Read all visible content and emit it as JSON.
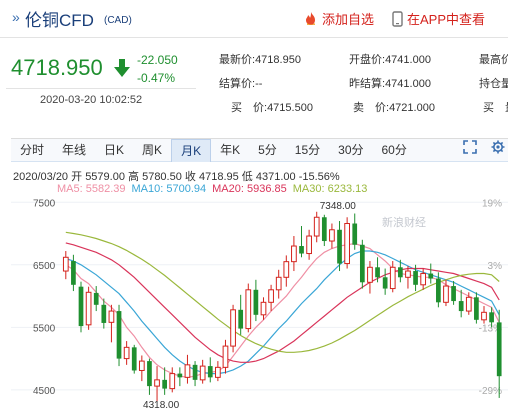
{
  "header": {
    "title_arrow": "»",
    "title": "伦铜CFD",
    "title_sub": "(CAD)",
    "add_watch_label": "添加自选",
    "app_view_label": "在APP中查看",
    "accent_color": "#d4221c"
  },
  "quote": {
    "price": "4718.950",
    "direction": "down",
    "change": "-22.050",
    "change_pct": "-0.47%",
    "timestamp": "2020-03-20 10:02:52",
    "down_color": "#1f8f2f"
  },
  "fields": {
    "col1": [
      {
        "label": "最新价:",
        "value": "4718.950"
      },
      {
        "label": "结算价:",
        "value": "--"
      },
      {
        "label": "买　价:",
        "value": "4715.500"
      }
    ],
    "col2": [
      {
        "label": "开盘价:",
        "value": "4741.000"
      },
      {
        "label": "昨结算:",
        "value": "4741.000"
      },
      {
        "label": "卖　价:",
        "value": "4721.000"
      }
    ],
    "col3": [
      {
        "label": "最高价:",
        "value": ""
      },
      {
        "label": "持仓量:",
        "value": ""
      },
      {
        "label": "买　量:",
        "value": ""
      }
    ]
  },
  "tabs": [
    "分时",
    "年线",
    "日K",
    "周K",
    "月K",
    "年K",
    "5分",
    "15分",
    "30分",
    "60分"
  ],
  "active_tab": 4,
  "tools": [
    "expand-icon",
    "settings-icon"
  ],
  "info": {
    "date": "2020/03/20",
    "open_label": "开",
    "open": "5579.00",
    "high_label": "高",
    "high": "5780.50",
    "close_label": "收",
    "close": "4718.95",
    "low_label": "低",
    "low": "4371.00",
    "change_pct": "-15.56%",
    "ma": [
      {
        "label": "MA5:",
        "value": "5582.39",
        "color": "#ef8fa4"
      },
      {
        "label": "MA10:",
        "value": "5700.94",
        "color": "#3aa6d6"
      },
      {
        "label": "MA20:",
        "value": "5936.85",
        "color": "#d9345a"
      },
      {
        "label": "MA30:",
        "value": "6233.13",
        "color": "#9ab83c"
      }
    ]
  },
  "chart_data": {
    "type": "candlestick",
    "y_ticks": [
      "7500",
      "6500",
      "5500",
      "4500"
    ],
    "y_tick_values": [
      7500,
      6500,
      5500,
      4500
    ],
    "pct_ticks": [
      "19%",
      "3%",
      "-13%",
      "-29%"
    ],
    "pct_tick_values": [
      7500,
      6500,
      5500,
      4500
    ],
    "ylim": [
      4210,
      7600
    ],
    "watermark": "新浪财经",
    "high_marker": "7348.00",
    "low_marker": "4318.00",
    "up_color": "#d4221c",
    "down_color": "#1f8f2f",
    "candles": [
      {
        "o": 6400,
        "h": 6720,
        "l": 6270,
        "c": 6620
      },
      {
        "o": 6560,
        "h": 6660,
        "l": 6080,
        "c": 6180
      },
      {
        "o": 6150,
        "h": 6230,
        "l": 5420,
        "c": 5520
      },
      {
        "o": 5540,
        "h": 6150,
        "l": 5460,
        "c": 6060
      },
      {
        "o": 6050,
        "h": 6160,
        "l": 5760,
        "c": 5860
      },
      {
        "o": 5860,
        "h": 5960,
        "l": 5480,
        "c": 5570
      },
      {
        "o": 5580,
        "h": 5860,
        "l": 5260,
        "c": 5760
      },
      {
        "o": 5760,
        "h": 5860,
        "l": 4880,
        "c": 5000
      },
      {
        "o": 5000,
        "h": 5280,
        "l": 4900,
        "c": 5180
      },
      {
        "o": 5180,
        "h": 5220,
        "l": 4760,
        "c": 4810
      },
      {
        "o": 4810,
        "h": 5050,
        "l": 4640,
        "c": 4960
      },
      {
        "o": 4960,
        "h": 5000,
        "l": 4420,
        "c": 4560
      },
      {
        "o": 4560,
        "h": 4880,
        "l": 4318,
        "c": 4660
      },
      {
        "o": 4660,
        "h": 4860,
        "l": 4420,
        "c": 4520
      },
      {
        "o": 4520,
        "h": 4860,
        "l": 4460,
        "c": 4760
      },
      {
        "o": 4760,
        "h": 4860,
        "l": 4560,
        "c": 4700
      },
      {
        "o": 4700,
        "h": 5060,
        "l": 4600,
        "c": 4900
      },
      {
        "o": 4900,
        "h": 4960,
        "l": 4560,
        "c": 4660
      },
      {
        "o": 4660,
        "h": 4980,
        "l": 4600,
        "c": 4880
      },
      {
        "o": 4880,
        "h": 5020,
        "l": 4620,
        "c": 4700
      },
      {
        "o": 4700,
        "h": 4960,
        "l": 4640,
        "c": 4860
      },
      {
        "o": 4860,
        "h": 5300,
        "l": 4760,
        "c": 5200
      },
      {
        "o": 5200,
        "h": 5860,
        "l": 5100,
        "c": 5780
      },
      {
        "o": 5780,
        "h": 6020,
        "l": 5380,
        "c": 5480
      },
      {
        "o": 5480,
        "h": 6200,
        "l": 5420,
        "c": 6100
      },
      {
        "o": 6100,
        "h": 6260,
        "l": 5600,
        "c": 5700
      },
      {
        "o": 5700,
        "h": 5980,
        "l": 5620,
        "c": 5900
      },
      {
        "o": 5900,
        "h": 6180,
        "l": 5760,
        "c": 6100
      },
      {
        "o": 6100,
        "h": 6420,
        "l": 5960,
        "c": 6300
      },
      {
        "o": 6300,
        "h": 6650,
        "l": 6150,
        "c": 6550
      },
      {
        "o": 6550,
        "h": 6960,
        "l": 6400,
        "c": 6800
      },
      {
        "o": 6800,
        "h": 7120,
        "l": 6620,
        "c": 6680
      },
      {
        "o": 6680,
        "h": 7060,
        "l": 6580,
        "c": 6960
      },
      {
        "o": 6960,
        "h": 7348,
        "l": 6860,
        "c": 7260
      },
      {
        "o": 7260,
        "h": 7300,
        "l": 6800,
        "c": 6880
      },
      {
        "o": 6880,
        "h": 7160,
        "l": 6760,
        "c": 7060
      },
      {
        "o": 7060,
        "h": 7200,
        "l": 6400,
        "c": 6520
      },
      {
        "o": 6520,
        "h": 7260,
        "l": 6440,
        "c": 7160
      },
      {
        "o": 7160,
        "h": 7320,
        "l": 6740,
        "c": 6820
      },
      {
        "o": 6820,
        "h": 6900,
        "l": 6120,
        "c": 6220
      },
      {
        "o": 6220,
        "h": 6560,
        "l": 6040,
        "c": 6460
      },
      {
        "o": 6460,
        "h": 6620,
        "l": 6220,
        "c": 6300
      },
      {
        "o": 6300,
        "h": 6440,
        "l": 6020,
        "c": 6120
      },
      {
        "o": 6120,
        "h": 6560,
        "l": 6060,
        "c": 6460
      },
      {
        "o": 6460,
        "h": 6580,
        "l": 6220,
        "c": 6300
      },
      {
        "o": 6300,
        "h": 6480,
        "l": 6120,
        "c": 6400
      },
      {
        "o": 6400,
        "h": 6500,
        "l": 6080,
        "c": 6180
      },
      {
        "o": 6180,
        "h": 6440,
        "l": 6100,
        "c": 6360
      },
      {
        "o": 6360,
        "h": 6520,
        "l": 6200,
        "c": 6280
      },
      {
        "o": 6280,
        "h": 6380,
        "l": 5820,
        "c": 5900
      },
      {
        "o": 5900,
        "h": 6260,
        "l": 5840,
        "c": 6160
      },
      {
        "o": 6160,
        "h": 6240,
        "l": 5860,
        "c": 5920
      },
      {
        "o": 5920,
        "h": 6100,
        "l": 5660,
        "c": 5760
      },
      {
        "o": 5760,
        "h": 6060,
        "l": 5700,
        "c": 5980
      },
      {
        "o": 5980,
        "h": 6060,
        "l": 5560,
        "c": 5620
      },
      {
        "o": 5620,
        "h": 5840,
        "l": 5560,
        "c": 5740
      },
      {
        "o": 5740,
        "h": 5820,
        "l": 5500,
        "c": 5580
      },
      {
        "o": 5579,
        "h": 5780.5,
        "l": 4371,
        "c": 4718.95
      }
    ],
    "ma_series": [
      {
        "name": "MA5",
        "color": "#ef8fa4",
        "values": [
          6500,
          6420,
          6280,
          6200,
          6060,
          5920,
          5820,
          5700,
          5500,
          5360,
          5180,
          5020,
          4900,
          4820,
          4760,
          4720,
          4700,
          4720,
          4760,
          4780,
          4800,
          4880,
          5040,
          5200,
          5360,
          5500,
          5620,
          5760,
          5880,
          6000,
          6160,
          6300,
          6460,
          6600,
          6700,
          6760,
          6800,
          6820,
          6840,
          6800,
          6760,
          6660,
          6560,
          6440,
          6360,
          6340,
          6320,
          6300,
          6300,
          6260,
          6180,
          6120,
          6060,
          6000,
          5940,
          5880,
          5820,
          5580
        ]
      },
      {
        "name": "MA10",
        "color": "#3aa6d6",
        "values": [
          6600,
          6560,
          6500,
          6420,
          6340,
          6240,
          6140,
          6040,
          5900,
          5760,
          5600,
          5460,
          5320,
          5180,
          5060,
          4960,
          4880,
          4820,
          4780,
          4760,
          4760,
          4780,
          4820,
          4880,
          4960,
          5080,
          5200,
          5340,
          5480,
          5600,
          5740,
          5880,
          6000,
          6120,
          6260,
          6380,
          6500,
          6600,
          6680,
          6720,
          6720,
          6700,
          6660,
          6600,
          6540,
          6480,
          6420,
          6380,
          6340,
          6300,
          6260,
          6220,
          6160,
          6100,
          6040,
          5980,
          5920,
          5700
        ]
      },
      {
        "name": "MA20",
        "color": "#d9345a",
        "values": [
          6850,
          6820,
          6780,
          6740,
          6700,
          6640,
          6580,
          6500,
          6400,
          6300,
          6180,
          6060,
          5940,
          5820,
          5700,
          5580,
          5460,
          5340,
          5240,
          5140,
          5060,
          5000,
          4960,
          4940,
          4940,
          4960,
          5000,
          5060,
          5120,
          5200,
          5280,
          5380,
          5480,
          5580,
          5680,
          5780,
          5880,
          5980,
          6060,
          6140,
          6220,
          6280,
          6340,
          6380,
          6420,
          6440,
          6440,
          6440,
          6420,
          6400,
          6380,
          6360,
          6320,
          6280,
          6240,
          6200,
          6140,
          5937
        ]
      },
      {
        "name": "MA30",
        "color": "#9ab83c",
        "values": [
          7020,
          7000,
          6980,
          6950,
          6920,
          6880,
          6840,
          6790,
          6730,
          6660,
          6590,
          6510,
          6420,
          6330,
          6230,
          6130,
          6030,
          5930,
          5830,
          5730,
          5630,
          5540,
          5450,
          5370,
          5300,
          5240,
          5190,
          5150,
          5120,
          5100,
          5100,
          5110,
          5130,
          5160,
          5200,
          5250,
          5310,
          5380,
          5450,
          5530,
          5610,
          5690,
          5770,
          5850,
          5920,
          5990,
          6050,
          6110,
          6170,
          6220,
          6260,
          6300,
          6330,
          6350,
          6360,
          6360,
          6340,
          6233
        ]
      }
    ]
  }
}
